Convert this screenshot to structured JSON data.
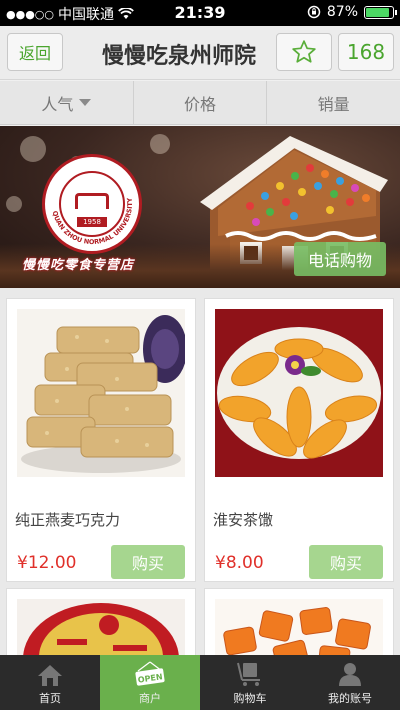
{
  "status_bar": {
    "carrier": "中国联通",
    "time": "21:39",
    "battery": "87%",
    "battery_level": 0.87
  },
  "header": {
    "back_label": "返回",
    "title": "慢慢吃泉州师院",
    "count": "168"
  },
  "sort_bar": {
    "items": [
      {
        "label": "人气",
        "has_caret": true
      },
      {
        "label": "价格",
        "has_caret": false
      },
      {
        "label": "销量",
        "has_caret": false
      }
    ]
  },
  "banner": {
    "logo_text": "QUAN ZHOU NORMAL UNIVERSITY",
    "logo_year": "1958",
    "caption": "慢慢吃零食专营店",
    "phone_button": "电话购物"
  },
  "products": [
    {
      "name": "纯正燕麦巧克力",
      "price": "¥12.00",
      "buy_label": "购买"
    },
    {
      "name": "淮安茶馓",
      "price": "¥8.00",
      "buy_label": "购买"
    },
    {
      "name": "",
      "price": "",
      "buy_label": ""
    },
    {
      "name": "",
      "price": "",
      "buy_label": ""
    }
  ],
  "tab_bar": {
    "tabs": [
      {
        "label": "首页",
        "icon": "home-icon",
        "active": false
      },
      {
        "label": "商户",
        "icon": "open-sign-icon",
        "active": true
      },
      {
        "label": "购物车",
        "icon": "cart-icon",
        "active": false
      },
      {
        "label": "我的账号",
        "icon": "user-icon",
        "active": false
      }
    ]
  },
  "colors": {
    "accent_green": "#6ab04c",
    "price_red": "#e0302a",
    "buy_green": "#a6d68f"
  }
}
